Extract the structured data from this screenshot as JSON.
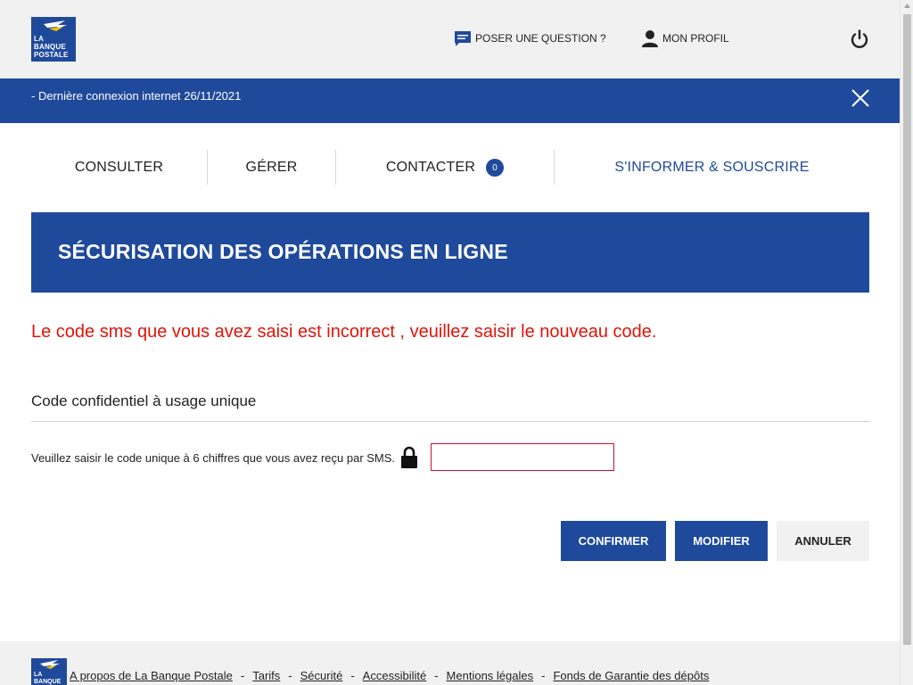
{
  "logo": {
    "lines": [
      "LA",
      "BANQUE",
      "POSTALE"
    ]
  },
  "header": {
    "question_label": "POSER UNE QUESTION ?",
    "profile_label": "MON PROFIL",
    "question_icon": "chat-icon",
    "profile_icon": "user-icon",
    "logout_icon": "power-icon"
  },
  "banner": {
    "text": "- Dernière connexion internet 26/11/2021",
    "close_icon": "close-icon"
  },
  "nav": {
    "items": [
      {
        "label": "CONSULTER"
      },
      {
        "label": "GÉRER"
      },
      {
        "label": "CONTACTER",
        "badge": "0"
      },
      {
        "label": "S'INFORMER & SOUSCRIRE"
      }
    ]
  },
  "page": {
    "title": "SÉCURISATION DES OPÉRATIONS EN LIGNE",
    "error_message": "Le code sms que vous avez saisi est incorrect , veuillez saisir le nouveau code.",
    "section_title": "Code confidentiel à usage unique",
    "code_label": "Veuillez saisir le code unique à 6 chiffres que vous avez reçu par SMS.",
    "code_value": "",
    "code_placeholder": "",
    "lock_icon": "lock-icon"
  },
  "buttons": {
    "confirm": "CONFIRMER",
    "modify": "MODIFIER",
    "cancel": "ANNULER"
  },
  "footer": {
    "links": [
      "A propos de La Banque Postale",
      "Tarifs",
      "Sécurité",
      "Accessibilité",
      "Mentions légales",
      "Fonds de Garantie des dépôts"
    ],
    "separator": "-"
  },
  "colors": {
    "brand_blue": "#1f4a9c",
    "error_red": "#e0140a",
    "header_bg": "#f1f1f1"
  }
}
